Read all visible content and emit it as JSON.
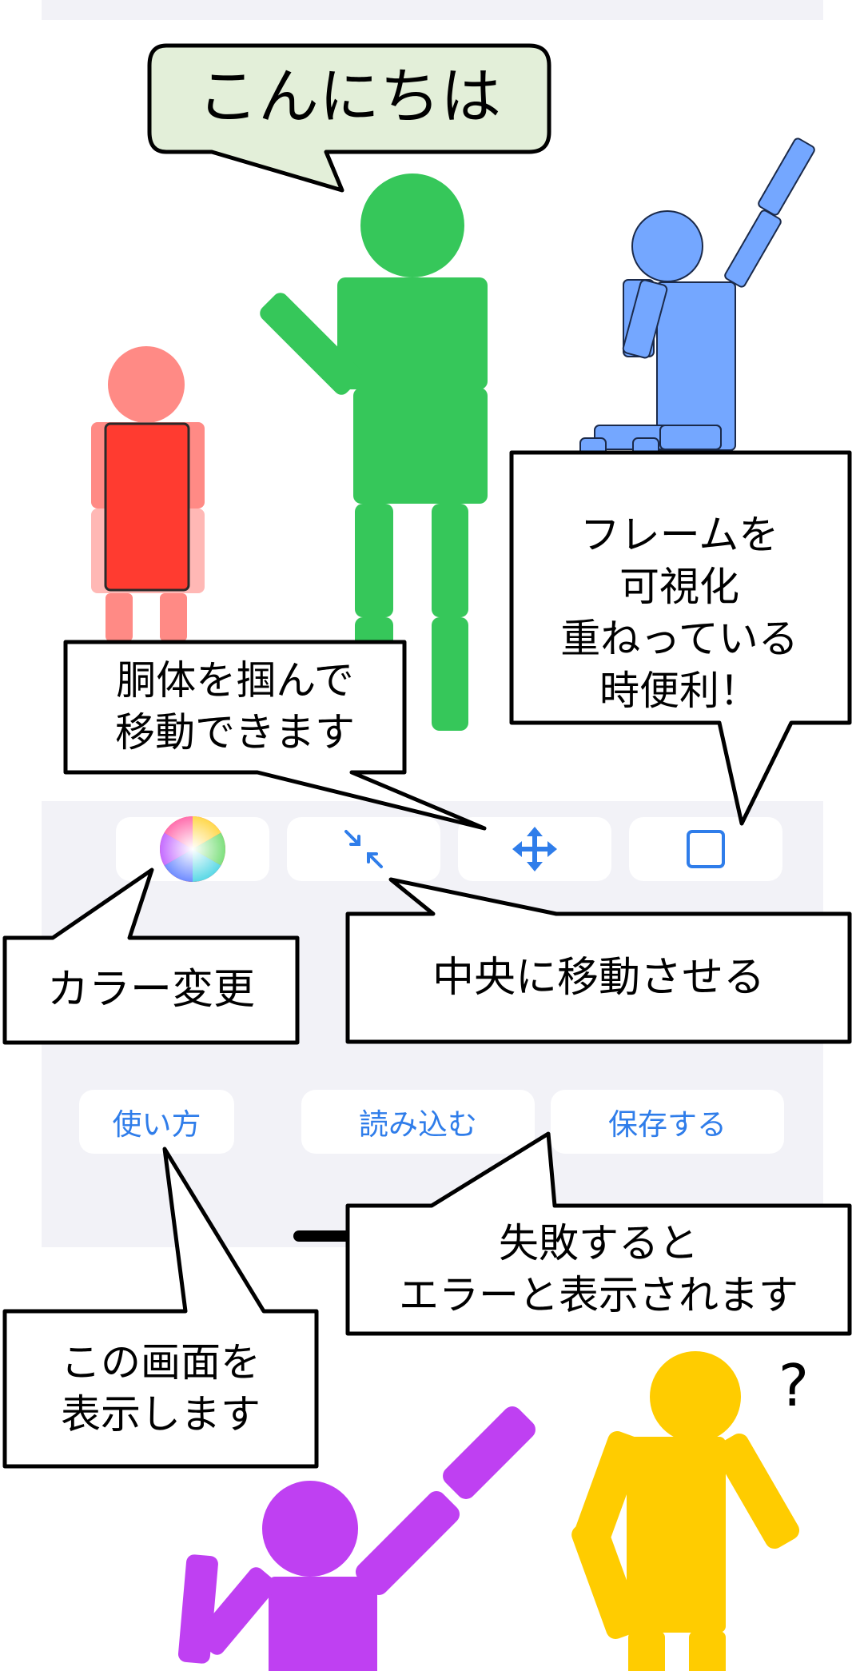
{
  "bubbles": {
    "hello": "こんにちは",
    "frame": [
      "フレームを",
      "可視化",
      "重ねっている",
      "時便利！"
    ],
    "grab": [
      "胴体を掴んで",
      "移動できます"
    ],
    "color": "カラー変更",
    "center": "中央に移動させる",
    "fail": [
      "失敗すると",
      "エラーと表示されます"
    ],
    "help": [
      "この画面を",
      "表示します"
    ]
  },
  "question_mark": "?",
  "toolbar": {
    "buttons": [
      {
        "icon": "color-wheel-icon"
      },
      {
        "icon": "center-arrows-icon"
      },
      {
        "icon": "move-arrows-icon"
      },
      {
        "icon": "square-frame-icon"
      }
    ]
  },
  "actions": {
    "help_label": "使い方",
    "load_label": "読み込む",
    "save_label": "保存する"
  },
  "colors": {
    "panel_background": "#f2f2f7",
    "accent_blue": "#2f7dea",
    "figure_green": "#36c75a",
    "figure_red": "#ff3b30",
    "figure_red_light": "#ff8a85",
    "figure_blue": "#74a7ff",
    "figure_purple": "#bf40f2",
    "figure_yellow": "#ffcc00",
    "bubble_green_fill": "#e3efd9"
  }
}
